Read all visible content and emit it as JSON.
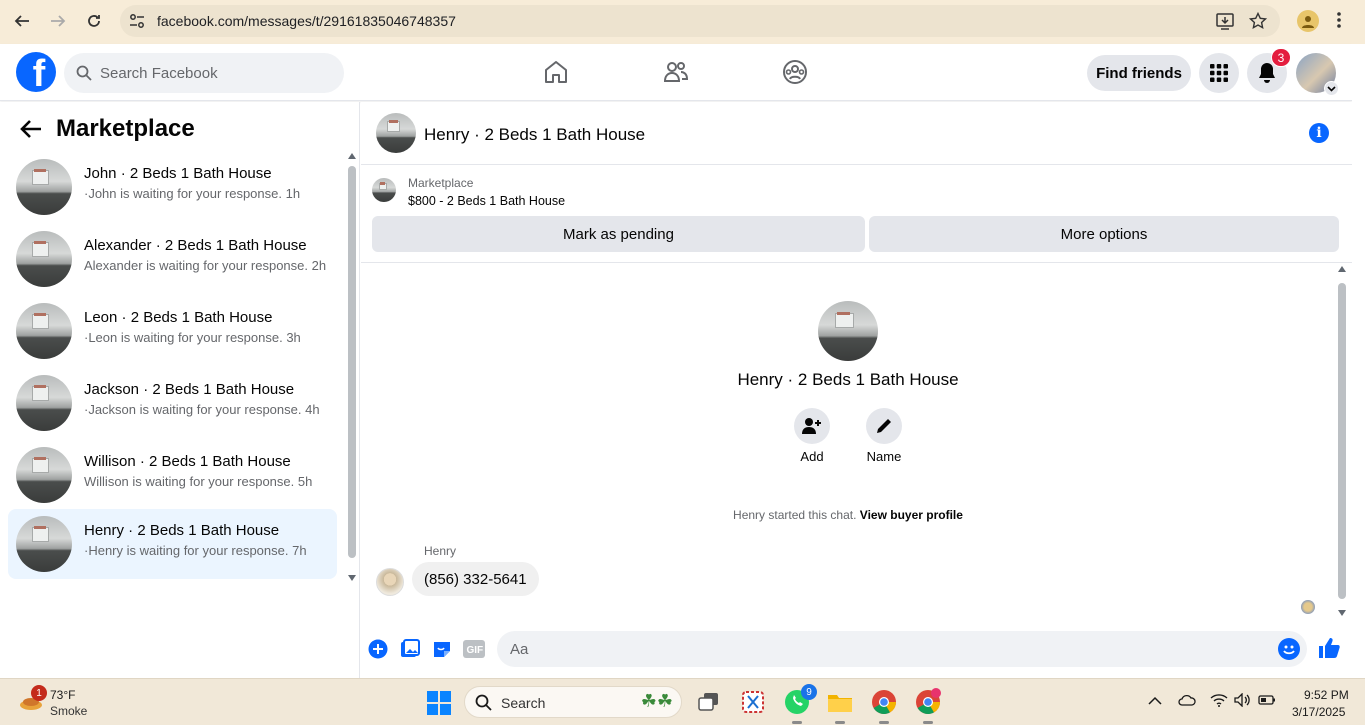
{
  "browser": {
    "url": "facebook.com/messages/t/29161835046748357"
  },
  "header": {
    "search_placeholder": "Search Facebook",
    "find_friends_label": "Find friends",
    "notification_count": "3"
  },
  "sidebar": {
    "title": "Marketplace",
    "conversations": [
      {
        "title": "John · 2 Beds 1 Bath House",
        "subtitle": "·John is waiting for your response. 1h"
      },
      {
        "title": "Alexander · 2 Beds 1 Bath House",
        "subtitle": "Alexander is waiting for your response. 2h"
      },
      {
        "title": "Leon · 2 Beds 1 Bath House",
        "subtitle": "·Leon is waiting for your response. 3h"
      },
      {
        "title": "Jackson · 2 Beds 1 Bath House",
        "subtitle": "·Jackson is waiting for your response. 4h"
      },
      {
        "title": "Willison · 2 Beds 1 Bath House",
        "subtitle": "Willison is waiting for your response. 5h"
      },
      {
        "title": "Henry · 2 Beds 1 Bath House",
        "subtitle": "·Henry is waiting for your response. 7h"
      }
    ]
  },
  "chat": {
    "title": "Henry · 2 Beds 1 Bath House",
    "listing_category": "Marketplace",
    "listing_price": "$800 - 2 Beds 1 Bath House",
    "mark_pending_label": "Mark as pending",
    "more_options_label": "More options",
    "center_name": "Henry · 2 Beds 1 Bath House",
    "add_label": "Add",
    "name_label": "Name",
    "started_text": "Henry started this chat.",
    "view_profile_label": "View buyer profile",
    "sender_name": "Henry",
    "message_text": "(856) 332-5641",
    "composer_placeholder": "Aa"
  },
  "taskbar": {
    "weather_badge": "1",
    "weather_temp": "73°F",
    "weather_desc": "Smoke",
    "search_label": "Search",
    "whatsapp_count": "9",
    "time": "9:52 PM",
    "date": "3/17/2025"
  },
  "colors": {
    "facebook_blue": "#0866ff",
    "active_conversation": "#ebf5ff",
    "badge_red": "#e41e3f"
  }
}
